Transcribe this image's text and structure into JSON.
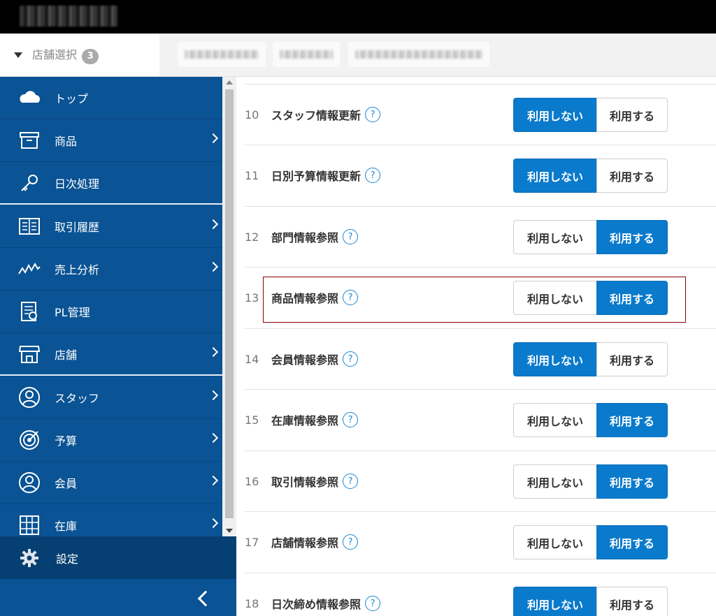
{
  "store_select": {
    "label": "店舗選択",
    "count": "3"
  },
  "sidebar": {
    "items": [
      {
        "label": "トップ",
        "icon": "cloud-icon"
      },
      {
        "label": "商品",
        "icon": "box-icon"
      },
      {
        "label": "日次処理",
        "icon": "key-icon"
      },
      {
        "label": "取引履歴",
        "icon": "ledger-icon"
      },
      {
        "label": "売上分析",
        "icon": "trend-icon"
      },
      {
        "label": "PL管理",
        "icon": "report-icon"
      },
      {
        "label": "店舗",
        "icon": "shop-icon"
      },
      {
        "label": "スタッフ",
        "icon": "staff-icon"
      },
      {
        "label": "予算",
        "icon": "target-icon"
      },
      {
        "label": "会員",
        "icon": "member-icon"
      },
      {
        "label": "在庫",
        "icon": "stock-icon"
      }
    ],
    "settings_label": "設定"
  },
  "toggle_labels": {
    "off": "利用しない",
    "on": "利用する"
  },
  "help_glyph": "?",
  "rows": [
    {
      "num": "10",
      "label": "スタッフ情報更新",
      "state": "off"
    },
    {
      "num": "11",
      "label": "日別予算情報更新",
      "state": "off"
    },
    {
      "num": "12",
      "label": "部門情報参照",
      "state": "on"
    },
    {
      "num": "13",
      "label": "商品情報参照",
      "state": "on"
    },
    {
      "num": "14",
      "label": "会員情報参照",
      "state": "off"
    },
    {
      "num": "15",
      "label": "在庫情報参照",
      "state": "on"
    },
    {
      "num": "16",
      "label": "取引情報参照",
      "state": "on"
    },
    {
      "num": "17",
      "label": "店舗情報参照",
      "state": "on"
    },
    {
      "num": "18",
      "label": "日次締め情報参照",
      "state": "off"
    }
  ],
  "colors": {
    "sidebar": "#0a5394",
    "accent": "#0a7acc",
    "highlight": "#8b0000"
  }
}
